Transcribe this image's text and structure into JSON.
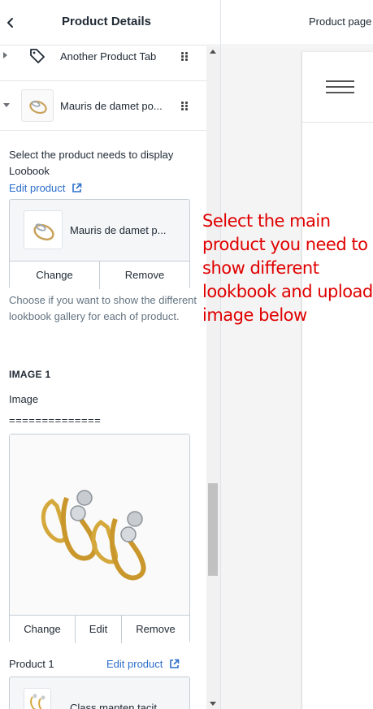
{
  "sidebar": {
    "title": "Product Details",
    "items": [
      {
        "label": "Another Product Tab",
        "icon": "tag-icon",
        "expanded": false
      },
      {
        "label": "Mauris de damet po...",
        "icon": "ring-thumbnail",
        "expanded": true
      }
    ],
    "product_picker": {
      "help": "Select the product needs to display Loobook",
      "edit_link": "Edit product",
      "product_name": "Mauris de damet p...",
      "change_label": "Change",
      "remove_label": "Remove",
      "note": "Choose if you want to show the different lookbook gallery for each of product."
    },
    "image_section": {
      "heading": "IMAGE 1",
      "image_label": "Image",
      "separator": "==============",
      "change_label": "Change",
      "edit_label": "Edit",
      "remove_label": "Remove"
    },
    "product_1": {
      "label": "Product 1",
      "edit_link": "Edit product",
      "product_name": "Class mapten tacit"
    }
  },
  "topbar": {
    "page_select": "Product page"
  },
  "annotation": "Select the main product you need to show different lookbook and upload image below",
  "colors": {
    "link": "#2c6ecb",
    "annotation": "#e00000",
    "border": "#c4cdd5"
  }
}
